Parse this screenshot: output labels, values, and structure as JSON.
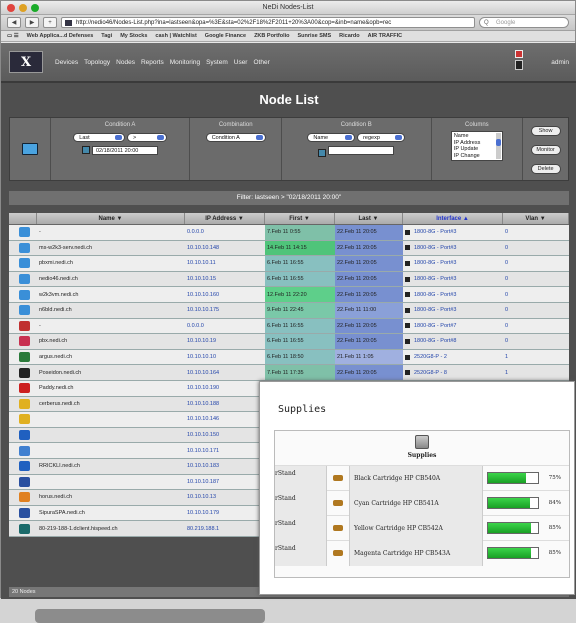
{
  "window": {
    "title": "NeDi Nodes-List"
  },
  "toolbar": {
    "url": "http://nedio46/Nodes-List.php?ina=lastseen&opa=%3E&sta=02%2F18%2F2011+20%3A00&cop=&inb=name&opb=rec",
    "search_placeholder": "Google"
  },
  "bookmarks": [
    "Web Applica...d Defenses",
    "Tagi",
    "My Stocks",
    "cash | Watchlist",
    "Google Finance",
    "ZKB Portfolio",
    "Sunrise SMS",
    "Ricardo",
    "AIR TRAFFIC"
  ],
  "nav": {
    "logo": "X",
    "menu": [
      "Devices",
      "Topology",
      "Nodes",
      "Reports",
      "Monitoring",
      "System",
      "User",
      "Other"
    ],
    "user": "admin"
  },
  "page_title": "Node List",
  "filters": {
    "cond_a_label": "Condition A",
    "cond_a_field": "Last",
    "cond_a_op": ">",
    "cond_a_value": "02/18/2011 20:00",
    "combination_label": "Combination",
    "combination_value": "Condition A",
    "cond_b_label": "Condition B",
    "cond_b_field": "Name",
    "cond_b_op": "regexp",
    "cond_b_value": "",
    "columns_label": "Columns",
    "columns_options": [
      "Name",
      "IP Address",
      "IP Update",
      "IP Change"
    ],
    "show_label": "Show",
    "monitor_label": "Monitor",
    "delete_label": "Delete"
  },
  "filter_summary": "Filter: lastseen > \"02/18/2011 20:00\"",
  "table": {
    "headers": [
      "Name ▼",
      "IP Address ▼",
      "First ▼",
      "Last ▼",
      "Interface ▲",
      "Vlan ▼"
    ],
    "rows": [
      {
        "icon": "#3a8fd8",
        "name": "-",
        "ip": "0.0.0.0",
        "first": "7.Feb 11 0:55",
        "last": "22.Feb 11 20:05",
        "iface": "1800-8G - Port#3",
        "vlan": "0",
        "fc": "#7fc0a8",
        "lc": "#7890d0"
      },
      {
        "icon": "#3a8fd8",
        "name": "ms-w2k3-serv.nedi.ch",
        "ip": "10.10.10.148",
        "first": "14.Feb 11 14:15",
        "last": "22.Feb 11 20:05",
        "iface": "1800-8G - Port#3",
        "vlan": "0",
        "fc": "#4fc47a",
        "lc": "#7890d0"
      },
      {
        "icon": "#3a8fd8",
        "name": "pbxmi.nedi.ch",
        "ip": "10.10.10.11",
        "first": "6.Feb 11 16:55",
        "last": "22.Feb 11 20:05",
        "iface": "1800-8G - Port#3",
        "vlan": "0",
        "fc": "#88c0c0",
        "lc": "#7890d0"
      },
      {
        "icon": "#3a8fd8",
        "name": "nedio46.nedi.ch",
        "ip": "10.10.10.15",
        "first": "6.Feb 11 16:55",
        "last": "22.Feb 11 20:05",
        "iface": "1800-8G - Port#3",
        "vlan": "0",
        "fc": "#88c0c0",
        "lc": "#7890d0"
      },
      {
        "icon": "#3a8fd8",
        "name": "w2k3vm.nedi.ch",
        "ip": "10.10.10.160",
        "first": "12.Feb 11 22:20",
        "last": "22.Feb 11 20:05",
        "iface": "1800-8G - Port#3",
        "vlan": "0",
        "fc": "#5ecf8a",
        "lc": "#7890d0"
      },
      {
        "icon": "#3a8fd8",
        "name": "n6bld.nedi.ch",
        "ip": "10.10.10.175",
        "first": "9.Feb 11 22:45",
        "last": "22.Feb 11 11:00",
        "iface": "1800-8G - Port#3",
        "vlan": "0",
        "fc": "#7ac8a8",
        "lc": "#8aa0d8"
      },
      {
        "icon": "#c03030",
        "name": "-",
        "ip": "0.0.0.0",
        "first": "6.Feb 11 16:55",
        "last": "22.Feb 11 20:05",
        "iface": "1800-8G - Port#7",
        "vlan": "0",
        "fc": "#88c0c0",
        "lc": "#7890d0"
      },
      {
        "icon": "#c83050",
        "name": "pbx.nedi.ch",
        "ip": "10.10.10.19",
        "first": "6.Feb 11 16:55",
        "last": "22.Feb 11 20:05",
        "iface": "1800-8G - Port#8",
        "vlan": "0",
        "fc": "#88c0c0",
        "lc": "#7890d0"
      },
      {
        "icon": "#2a7a3a",
        "name": "argus.nedi.ch",
        "ip": "10.10.10.10",
        "first": "6.Feb 11 18:50",
        "last": "21.Feb 11 1:05",
        "iface": "2520G8-P - 2",
        "vlan": "1",
        "fc": "#88c0c0",
        "lc": "#a0b0e0"
      },
      {
        "icon": "#222222",
        "name": "Poseidon.nedi.ch",
        "ip": "10.10.10.164",
        "first": "7.Feb 11 17:35",
        "last": "22.Feb 11 20:05",
        "iface": "2520G8-P - 8",
        "vlan": "1",
        "fc": "#7fc0a8",
        "lc": "#7890d0"
      },
      {
        "icon": "#cc2020",
        "name": "Paddy.nedi.ch",
        "ip": "10.10.10.190",
        "first": "",
        "last": "",
        "iface": "",
        "vlan": "",
        "fc": "#eaeaea",
        "lc": "#eaeaea"
      },
      {
        "icon": "#e0b020",
        "name": "cerberus.nedi.ch",
        "ip": "10.10.10.188",
        "first": "",
        "last": "",
        "iface": "",
        "vlan": "",
        "fc": "#eaeaea",
        "lc": "#eaeaea"
      },
      {
        "icon": "#e0b020",
        "name": "",
        "ip": "10.10.10.146",
        "first": "",
        "last": "",
        "iface": "",
        "vlan": "",
        "fc": "#eaeaea",
        "lc": "#eaeaea"
      },
      {
        "icon": "#2060c0",
        "name": "",
        "ip": "10.10.10.150",
        "first": "",
        "last": "",
        "iface": "",
        "vlan": "",
        "fc": "#eaeaea",
        "lc": "#eaeaea"
      },
      {
        "icon": "#4080d0",
        "name": "",
        "ip": "10.10.10.171",
        "first": "",
        "last": "",
        "iface": "",
        "vlan": "",
        "fc": "#eaeaea",
        "lc": "#eaeaea"
      },
      {
        "icon": "#2060c0",
        "name": "RRICKLI.nedi.ch",
        "ip": "10.10.10.183",
        "first": "",
        "last": "",
        "iface": "",
        "vlan": "",
        "fc": "#eaeaea",
        "lc": "#eaeaea"
      },
      {
        "icon": "#2a50a0",
        "name": "",
        "ip": "10.10.10.187",
        "first": "",
        "last": "",
        "iface": "",
        "vlan": "",
        "fc": "#eaeaea",
        "lc": "#eaeaea"
      },
      {
        "icon": "#e08020",
        "name": "horus.nedi.ch",
        "ip": "10.10.10.13",
        "first": "",
        "last": "",
        "iface": "",
        "vlan": "",
        "fc": "#eaeaea",
        "lc": "#eaeaea"
      },
      {
        "icon": "#2a50a0",
        "name": "SipuraSPA.nedi.ch",
        "ip": "10.10.10.179",
        "first": "",
        "last": "",
        "iface": "",
        "vlan": "",
        "fc": "#eaeaea",
        "lc": "#eaeaea"
      },
      {
        "icon": "#1a6a6a",
        "name": "80-219-188-1.dclient.hispeed.ch",
        "ip": "80.219.188.1",
        "first": "",
        "last": "",
        "iface": "",
        "vlan": "",
        "fc": "#eaeaea",
        "lc": "#eaeaea"
      }
    ],
    "footer": "20 Nodes"
  },
  "overlay": {
    "title": "Supplies",
    "header": "Supplies",
    "items": [
      {
        "stand": "rStand",
        "name": "Black Cartridge HP CB540A",
        "level": 0.75,
        "pct": "75%"
      },
      {
        "stand": "rStand",
        "name": "Cyan Cartridge HP CB541A",
        "level": 0.84,
        "pct": "84%"
      },
      {
        "stand": "rStand",
        "name": "Yellow Cartridge HP CB542A",
        "level": 0.85,
        "pct": "85%"
      },
      {
        "stand": "rStand",
        "name": "Magenta Cartridge HP CB543A",
        "level": 0.85,
        "pct": "85%"
      }
    ]
  }
}
